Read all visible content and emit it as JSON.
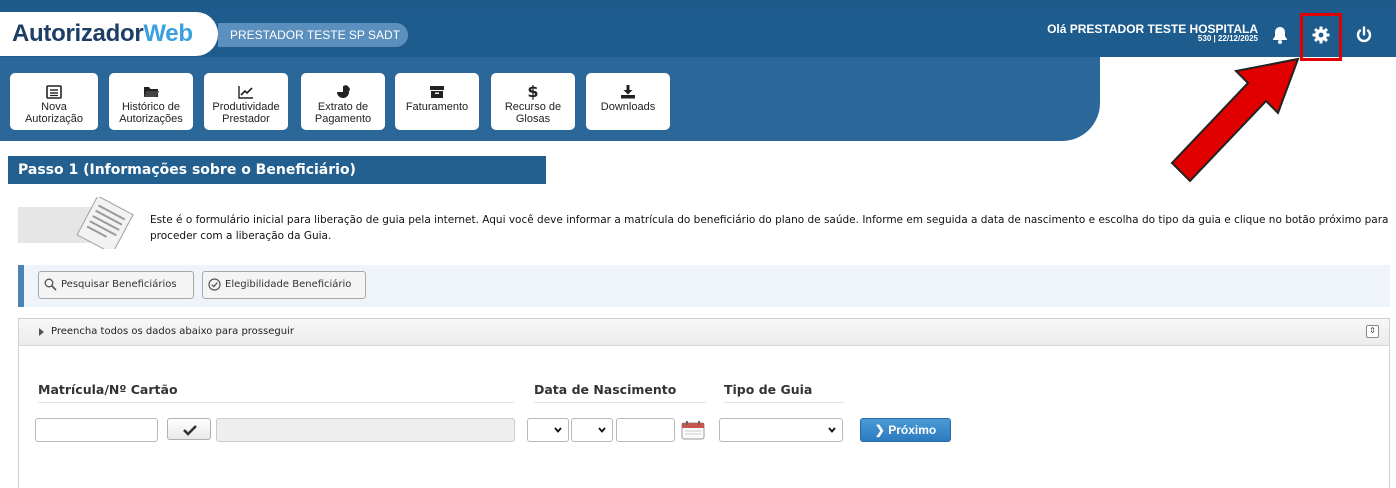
{
  "header": {
    "logo_main": "Autorizador",
    "logo_accent": "Web",
    "provider": "PRESTADOR TESTE SP SADT",
    "greeting": "Olá PRESTADOR TESTE HOSPITALA",
    "sub_greeting": "530 | 22/12/2025"
  },
  "nav": [
    {
      "line1": "Nova",
      "line2": "Autorização",
      "icon": "list-icon"
    },
    {
      "line1": "Histórico de",
      "line2": "Autorizações",
      "icon": "folder-icon"
    },
    {
      "line1": "Produtividade",
      "line2": "Prestador",
      "icon": "chart-line-icon"
    },
    {
      "line1": "Extrato de",
      "line2": "Pagamento",
      "icon": "pie-chart-icon"
    },
    {
      "line1": "Faturamento",
      "line2": "",
      "icon": "archive-icon"
    },
    {
      "line1": "Recurso de",
      "line2": "Glosas",
      "icon": "dollar-icon"
    },
    {
      "line1": "Downloads",
      "line2": "",
      "icon": "download-icon"
    }
  ],
  "step": {
    "title": "Passo 1 (Informações sobre o Beneficiário)"
  },
  "info": {
    "text": "Este é o formulário inicial para liberação de guia pela internet. Aqui você deve informar a matrícula do beneficiário do plano de saúde. Informe em seguida a data de nascimento e escolha do tipo da guia e clique no botão próximo para proceder com a liberação da Guia."
  },
  "actions": {
    "search": "Pesquisar Beneficiários",
    "eligibility": "Elegibilidade Beneficiário"
  },
  "panel": {
    "header": "Preencha todos os dados abaixo para prosseguir"
  },
  "form": {
    "matricula_label": "Matrícula/Nº Cartão",
    "nascimento_label": "Data de Nascimento",
    "tipo_label": "Tipo de Guia",
    "next_label": "Próximo"
  },
  "colors": {
    "header_blue": "#1e5c8d",
    "accent": "#3aa0e0",
    "highlight": "#e00000"
  }
}
